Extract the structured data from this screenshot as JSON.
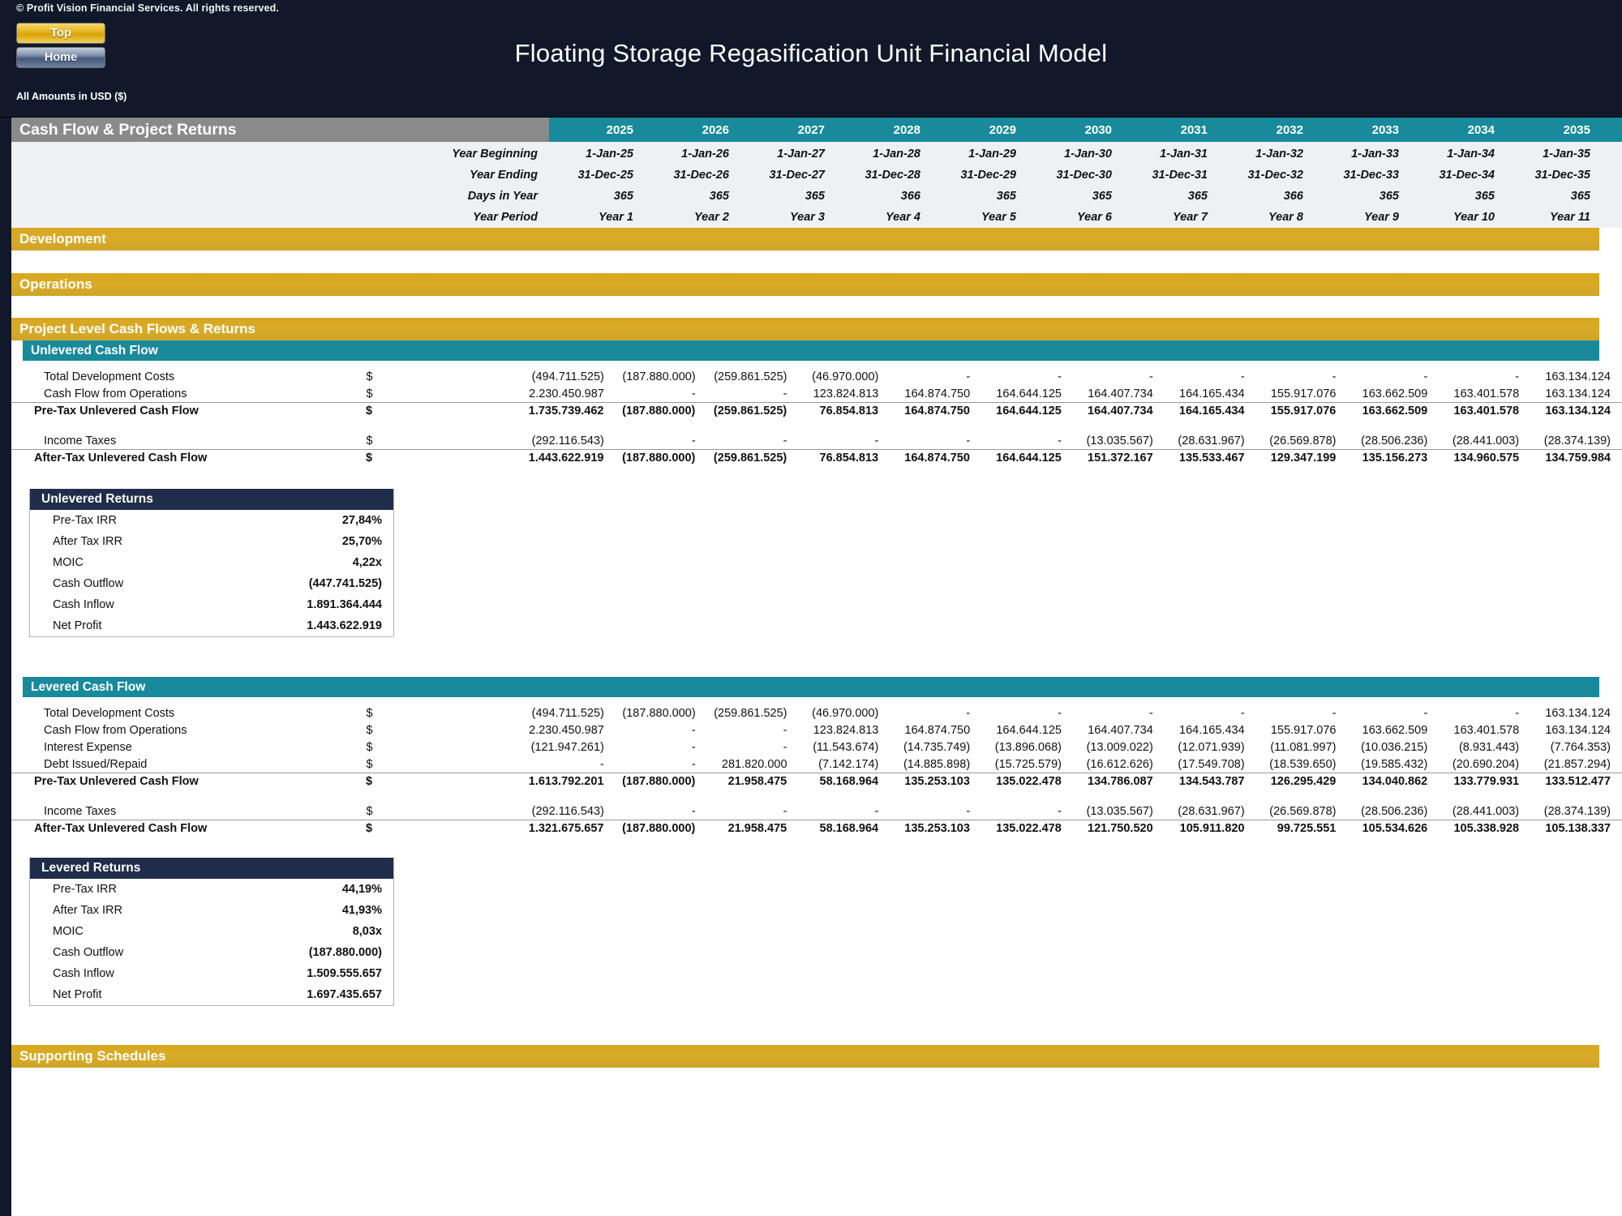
{
  "header": {
    "copyright": "© Profit Vision Financial Services. All rights reserved.",
    "btn_top": "Top",
    "btn_home": "Home",
    "title": "Floating Storage Regasification Unit Financial Model",
    "amounts_note": "All Amounts in  USD ($)"
  },
  "sheet": {
    "title": "Cash Flow & Project Returns",
    "years": [
      "2025",
      "2026",
      "2027",
      "2028",
      "2029",
      "2030",
      "2031",
      "2032",
      "2033",
      "2034",
      "2035"
    ],
    "period_rows": [
      {
        "label": "Year Beginning",
        "values": [
          "1-Jan-25",
          "1-Jan-26",
          "1-Jan-27",
          "1-Jan-28",
          "1-Jan-29",
          "1-Jan-30",
          "1-Jan-31",
          "1-Jan-32",
          "1-Jan-33",
          "1-Jan-34",
          "1-Jan-35"
        ]
      },
      {
        "label": "Year Ending",
        "values": [
          "31-Dec-25",
          "31-Dec-26",
          "31-Dec-27",
          "31-Dec-28",
          "31-Dec-29",
          "31-Dec-30",
          "31-Dec-31",
          "31-Dec-32",
          "31-Dec-33",
          "31-Dec-34",
          "31-Dec-35"
        ]
      },
      {
        "label": "Days in Year",
        "values": [
          "365",
          "365",
          "365",
          "366",
          "365",
          "365",
          "365",
          "366",
          "365",
          "365",
          "365"
        ]
      },
      {
        "label": "Year Period",
        "values": [
          "Year 1",
          "Year 2",
          "Year 3",
          "Year 4",
          "Year 5",
          "Year 6",
          "Year 7",
          "Year 8",
          "Year 9",
          "Year 10",
          "Year 11"
        ]
      }
    ],
    "section_development": "Development",
    "section_operations": "Operations",
    "section_project_level": "Project Level Cash Flows & Returns",
    "section_supporting": "Supporting Schedules",
    "unlevered": {
      "header": "Unlevered Cash Flow",
      "rows": [
        {
          "label": "Total Development Costs",
          "unit": "$",
          "bold": false,
          "values": [
            "(494.711.525)",
            "(187.880.000)",
            "(259.861.525)",
            "(46.970.000)",
            "-",
            "-",
            "-",
            "-",
            "-",
            "-",
            "-"
          ]
        },
        {
          "label": "Cash Flow from Operations",
          "unit": "$",
          "bold": false,
          "values": [
            "2.230.450.987",
            "-",
            "-",
            "123.824.813",
            "164.874.750",
            "164.644.125",
            "164.407.734",
            "164.165.434",
            "155.917.076",
            "163.662.509",
            "163.401.578"
          ]
        },
        {
          "label": "Pre-Tax Unlevered Cash Flow",
          "unit": "$",
          "bold": true,
          "values": [
            "1.735.739.462",
            "(187.880.000)",
            "(259.861.525)",
            "76.854.813",
            "164.874.750",
            "164.644.125",
            "164.407.734",
            "164.165.434",
            "155.917.076",
            "163.662.509",
            "163.401.578"
          ]
        },
        {
          "label": "Income Taxes",
          "unit": "$",
          "bold": false,
          "values": [
            "(292.116.543)",
            "-",
            "-",
            "-",
            "-",
            "-",
            "(13.035.567)",
            "(28.631.967)",
            "(26.569.878)",
            "(28.506.236)",
            "(28.441.003)"
          ]
        },
        {
          "label": "After-Tax Unlevered Cash Flow",
          "unit": "$",
          "bold": true,
          "values": [
            "1.443.622.919",
            "(187.880.000)",
            "(259.861.525)",
            "76.854.813",
            "164.874.750",
            "164.644.125",
            "151.372.167",
            "135.533.467",
            "129.347.199",
            "135.156.273",
            "134.960.575"
          ]
        }
      ],
      "extra_col": [
        "163.134.124",
        "163.134.124",
        "163.134.124",
        "(28.374.139)",
        "134.759.984"
      ]
    },
    "unlevered_returns": {
      "header": "Unlevered Returns",
      "rows": [
        {
          "label": "Pre-Tax IRR",
          "value": "27,84%"
        },
        {
          "label": "After Tax IRR",
          "value": "25,70%"
        },
        {
          "label": "MOIC",
          "value": "4,22x"
        },
        {
          "label": "Cash Outflow",
          "value": "(447.741.525)"
        },
        {
          "label": "Cash Inflow",
          "value": "1.891.364.444"
        },
        {
          "label": "Net Profit",
          "value": "1.443.622.919"
        }
      ]
    },
    "levered": {
      "header": "Levered Cash Flow",
      "rows": [
        {
          "label": "Total Development Costs",
          "unit": "$",
          "bold": false,
          "values": [
            "(494.711.525)",
            "(187.880.000)",
            "(259.861.525)",
            "(46.970.000)",
            "-",
            "-",
            "-",
            "-",
            "-",
            "-",
            "-"
          ]
        },
        {
          "label": "Cash Flow from Operations",
          "unit": "$",
          "bold": false,
          "values": [
            "2.230.450.987",
            "-",
            "-",
            "123.824.813",
            "164.874.750",
            "164.644.125",
            "164.407.734",
            "164.165.434",
            "155.917.076",
            "163.662.509",
            "163.401.578"
          ]
        },
        {
          "label": "Interest Expense",
          "unit": "$",
          "bold": false,
          "values": [
            "(121.947.261)",
            "-",
            "-",
            "(11.543.674)",
            "(14.735.749)",
            "(13.896.068)",
            "(13.009.022)",
            "(12.071.939)",
            "(11.081.997)",
            "(10.036.215)",
            "(8.931.443)"
          ]
        },
        {
          "label": "Debt Issued/Repaid",
          "unit": "$",
          "bold": false,
          "values": [
            "-",
            "-",
            "281.820.000",
            "(7.142.174)",
            "(14.885.898)",
            "(15.725.579)",
            "(16.612.626)",
            "(17.549.708)",
            "(18.539.650)",
            "(19.585.432)",
            "(20.690.204)"
          ]
        },
        {
          "label": "Pre-Tax Unlevered Cash Flow",
          "unit": "$",
          "bold": true,
          "values": [
            "1.613.792.201",
            "(187.880.000)",
            "21.958.475",
            "58.168.964",
            "135.253.103",
            "135.022.478",
            "134.786.087",
            "134.543.787",
            "126.295.429",
            "134.040.862",
            "133.779.931"
          ]
        },
        {
          "label": "Income Taxes",
          "unit": "$",
          "bold": false,
          "values": [
            "(292.116.543)",
            "-",
            "-",
            "-",
            "-",
            "-",
            "(13.035.567)",
            "(28.631.967)",
            "(26.569.878)",
            "(28.506.236)",
            "(28.441.003)"
          ]
        },
        {
          "label": "After-Tax Unlevered Cash Flow",
          "unit": "$",
          "bold": true,
          "values": [
            "1.321.675.657",
            "(187.880.000)",
            "21.958.475",
            "58.168.964",
            "135.253.103",
            "135.022.478",
            "121.750.520",
            "105.911.820",
            "99.725.551",
            "105.534.626",
            "105.338.928"
          ]
        }
      ],
      "extra_col": [
        "163.134.124",
        "163.134.124",
        "(7.764.353)",
        "(21.857.294)",
        "133.512.477",
        "(28.374.139)",
        "105.138.337"
      ]
    },
    "levered_returns": {
      "header": "Levered Returns",
      "rows": [
        {
          "label": "Pre-Tax IRR",
          "value": "44,19%"
        },
        {
          "label": "After Tax IRR",
          "value": "41,93%"
        },
        {
          "label": "MOIC",
          "value": "8,03x"
        },
        {
          "label": "Cash Outflow",
          "value": "(187.880.000)"
        },
        {
          "label": "Cash Inflow",
          "value": "1.509.555.657"
        },
        {
          "label": "Net Profit",
          "value": "1.697.435.657"
        }
      ]
    }
  },
  "colors": {
    "teal": "#188a9c",
    "gold": "#d8a71d",
    "navy": "#1f2d4a",
    "dark": "#11182a"
  }
}
